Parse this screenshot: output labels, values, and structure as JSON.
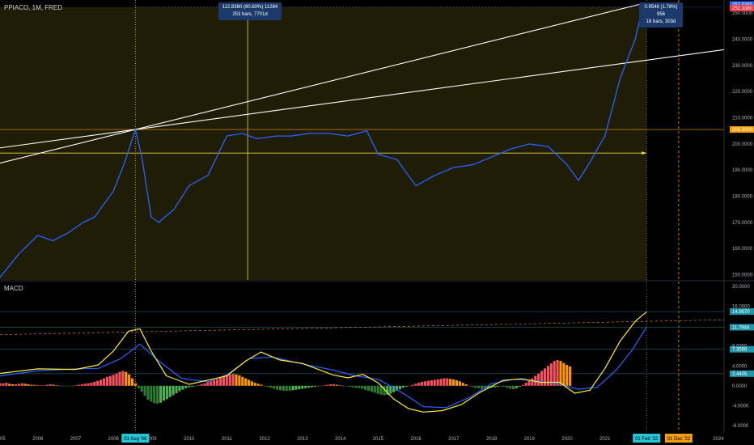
{
  "header": {
    "symbol_title": "PPIACO, 1M, FRED"
  },
  "measure_main": {
    "line1": "112.8380 (80.60%) 11284",
    "line2": "253 bars, 7701d"
  },
  "measure_right": {
    "line1": "0.9546 (1.78%) 956",
    "line2": "18 bars, 303d"
  },
  "macd": {
    "title": "MACD"
  },
  "price_tags": [
    {
      "value": "252.6380",
      "color": "#2962ff"
    },
    {
      "value": "252.3380",
      "color": "#f23645"
    },
    {
      "value": "205.5000",
      "color": "#f59d0b"
    }
  ],
  "macd_tags": [
    {
      "value": "14.9570",
      "color": "#2196a8"
    },
    {
      "value": "11.7944",
      "color": "#2196a8"
    },
    {
      "value": "7.3566",
      "color": "#2196a8"
    },
    {
      "value": "2.4405",
      "color": "#2196a8"
    }
  ],
  "date_tags": [
    {
      "value": "01 Aug '08",
      "color": "#26c6da"
    },
    {
      "value": "01 Feb '22",
      "color": "#26c6da"
    },
    {
      "value": "01 Dec '22",
      "color": "#f59d0b"
    }
  ],
  "chart_data": {
    "type": "line",
    "panels": [
      {
        "name": "price",
        "y_ticks": [
          "250.0000",
          "240.0000",
          "230.0000",
          "220.0000",
          "210.0000",
          "200.0000",
          "190.0000",
          "180.0000",
          "170.0000",
          "160.0000",
          "150.0000"
        ],
        "ylim": [
          148,
          255
        ],
        "series": [
          {
            "x": [
              2005.0,
              2005.5,
              2006.0,
              2006.4,
              2006.8,
              2007.2,
              2007.5,
              2008.0,
              2008.3,
              2008.58,
              2008.75,
              2009.0,
              2009.2,
              2009.6,
              2010.0,
              2010.5,
              2011.0,
              2011.4,
              2011.8,
              2012.3,
              2012.7,
              2013.2,
              2013.7,
              2014.2,
              2014.7,
              2015.0,
              2015.5,
              2016.0,
              2016.5,
              2017.0,
              2017.5,
              2018.0,
              2018.5,
              2019.0,
              2019.5,
              2020.0,
              2020.3,
              2020.6,
              2021.0,
              2021.4,
              2021.8,
              2022.0,
              2022.1
            ],
            "y": [
              149,
              158,
              165,
              163,
              166,
              170,
              172,
              182,
              193,
              205.5,
              195,
              172,
              170,
              175,
              184,
              188,
              203,
              204,
              202,
              203,
              203,
              204,
              204,
              203,
              205,
              196,
              194,
              184,
              188,
              191,
              192,
              195,
              198,
              200,
              199,
              192,
              186,
              193,
              203,
              225,
              240,
              252.6,
              254
            ]
          }
        ],
        "hlines": [
          205.5,
          196.5,
          252.3
        ]
      },
      {
        "name": "macd",
        "y_ticks": [
          "20.0000",
          "16.0000",
          "12.0000",
          "8.0000",
          "4.0000",
          "0.0000",
          "-4.0000",
          "-8.0000"
        ],
        "ylim": [
          -9,
          21
        ],
        "series": [
          {
            "name": "MACD",
            "x": [
              2005.0,
              2006.0,
              2007.0,
              2007.6,
              2008.0,
              2008.4,
              2008.7,
              2009.0,
              2009.4,
              2010.0,
              2010.6,
              2011.0,
              2011.5,
              2011.9,
              2012.4,
              2013.0,
              2013.8,
              2014.2,
              2014.6,
              2015.0,
              2015.4,
              2015.8,
              2016.2,
              2016.7,
              2017.2,
              2017.7,
              2018.3,
              2018.8,
              2019.3,
              2019.8,
              2020.2,
              2020.6,
              2021.0,
              2021.4,
              2021.8,
              2022.1
            ],
            "y": [
              2.5,
              3.4,
              3.3,
              4.2,
              7.0,
              11.0,
              11.5,
              7.0,
              2.0,
              0.3,
              1.3,
              2.0,
              5.0,
              6.8,
              5.2,
              4.5,
              2.2,
              1.6,
              2.3,
              0.6,
              -2.6,
              -4.6,
              -5.3,
              -5.0,
              -3.8,
              -1.3,
              1.1,
              1.4,
              0.7,
              0.7,
              -1.5,
              -0.9,
              3.5,
              9.0,
              13.0,
              14.9
            ]
          },
          {
            "name": "Signal",
            "x": [
              2005.0,
              2006.0,
              2007.0,
              2007.6,
              2008.2,
              2008.7,
              2009.2,
              2009.8,
              2010.5,
              2011.0,
              2011.6,
              2012.2,
              2013.0,
              2013.8,
              2014.4,
              2015.0,
              2015.6,
              2016.2,
              2016.8,
              2017.4,
              2018.0,
              2018.6,
              2019.2,
              2019.8,
              2020.3,
              2020.8,
              2021.3,
              2021.7,
              2022.1
            ],
            "y": [
              2.0,
              3.0,
              3.4,
              3.5,
              5.5,
              8.4,
              5.0,
              1.5,
              0.8,
              2.2,
              5.5,
              5.8,
              4.4,
              3.2,
              2.0,
              1.3,
              -1.2,
              -4.2,
              -4.4,
              -2.4,
              0.4,
              1.3,
              1.0,
              0.3,
              -0.7,
              -0.3,
              3.2,
              7.0,
              11.8
            ]
          }
        ],
        "histogram": {
          "x_start": 2005.0,
          "x_step": 0.0833,
          "values": [
            0.5,
            0.5,
            0.6,
            0.4,
            0.3,
            0.3,
            0.4,
            0.5,
            0.4,
            0.3,
            0.2,
            0.2,
            0.1,
            0.1,
            0.1,
            0.2,
            0.3,
            0.2,
            0.1,
            0.0,
            -0.1,
            -0.1,
            -0.1,
            0.0,
            0.1,
            0.2,
            0.3,
            0.4,
            0.5,
            0.6,
            0.8,
            1.0,
            1.2,
            1.5,
            1.8,
            2.0,
            2.2,
            2.5,
            2.8,
            3.0,
            2.8,
            2.3,
            1.5,
            0.5,
            -0.5,
            -1.2,
            -2.0,
            -2.8,
            -3.2,
            -3.5,
            -3.6,
            -3.4,
            -3.0,
            -2.7,
            -2.3,
            -1.9,
            -1.5,
            -1.1,
            -0.8,
            -0.5,
            -0.3,
            -0.2,
            -0.1,
            0.1,
            0.3,
            0.5,
            0.7,
            0.9,
            1.1,
            1.3,
            1.6,
            1.9,
            2.1,
            2.3,
            2.4,
            2.3,
            2.1,
            1.8,
            1.5,
            1.2,
            0.9,
            0.6,
            0.4,
            0.2,
            0.0,
            -0.2,
            -0.4,
            -0.6,
            -0.8,
            -0.9,
            -1.0,
            -1.0,
            -1.0,
            -0.9,
            -0.8,
            -0.7,
            -0.6,
            -0.5,
            -0.4,
            -0.3,
            -0.2,
            -0.1,
            0.0,
            0.1,
            0.2,
            0.3,
            0.3,
            0.2,
            0.1,
            0.0,
            -0.1,
            -0.2,
            -0.3,
            -0.4,
            -0.5,
            -0.6,
            -0.8,
            -1.0,
            -1.2,
            -1.4,
            -1.6,
            -1.8,
            -1.9,
            -1.8,
            -1.6,
            -1.3,
            -1.0,
            -0.7,
            -0.4,
            -0.2,
            0.0,
            0.2,
            0.4,
            0.6,
            0.8,
            0.9,
            1.0,
            1.1,
            1.2,
            1.3,
            1.4,
            1.5,
            1.5,
            1.4,
            1.3,
            1.1,
            0.9,
            0.6,
            0.3,
            0.0,
            -0.2,
            -0.4,
            -0.5,
            -0.6,
            -0.6,
            -0.5,
            -0.4,
            -0.3,
            -0.2,
            -0.1,
            -0.2,
            -0.4,
            -0.6,
            -0.7,
            -0.5,
            -0.2,
            0.2,
            0.6,
            1.0,
            1.5,
            2.0,
            2.5,
            3.0,
            3.5,
            4.0,
            4.5,
            5.0,
            5.2,
            5.0,
            4.6,
            4.2,
            3.9
          ]
        },
        "hlines": [
          14.957,
          11.7944,
          7.3566,
          2.4405
        ]
      }
    ],
    "x_ticks": [
      "2005",
      "2006",
      "2007",
      "2008",
      "2009",
      "2010",
      "2011",
      "2012",
      "2013",
      "2014",
      "2015",
      "2016",
      "2017",
      "2018",
      "2019",
      "2020",
      "2021",
      "2022",
      "2023",
      "2024"
    ],
    "xlim": [
      2005.0,
      2024.15
    ],
    "colors": {
      "price": "#2962ff",
      "macd": "#ffeb3b",
      "signal": "#2962ff",
      "hist_pos_up": "#f7525f",
      "hist_pos_down": "#ff9800",
      "hist_neg_up": "#4caf50",
      "hist_neg_down": "#2e7d32",
      "range_fill": "#1f1d05"
    }
  }
}
